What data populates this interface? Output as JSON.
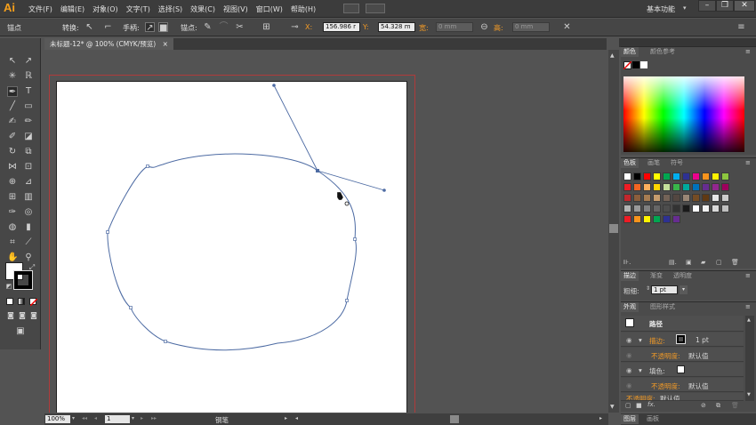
{
  "app": {
    "logo": "Ai",
    "menu": [
      "文件(F)",
      "编辑(E)",
      "对象(O)",
      "文字(T)",
      "选择(S)",
      "效果(C)",
      "视图(V)",
      "窗口(W)",
      "帮助(H)"
    ],
    "workspace": "基本功能"
  },
  "control_bar": {
    "object_label": "锚点",
    "convert_label": "转换:",
    "handles_label": "手柄:",
    "anchors_label": "锚点:",
    "x_label": "X:",
    "x_value": "156.986 r",
    "y_label": "Y:",
    "y_value": "54.328 m",
    "w_label": "宽:",
    "w_value": "0 mm",
    "h_label": "高:",
    "h_value": "0 mm"
  },
  "document": {
    "tab_title": "未标题-12* @ 100% (CMYK/预览)"
  },
  "status_bar": {
    "zoom": "100%",
    "page": "1",
    "tool": "钢笔"
  },
  "panels": {
    "color": {
      "tabs": [
        "颜色",
        "颜色参考"
      ]
    },
    "swatches": {
      "tabs": [
        "色板",
        "画笔",
        "符号"
      ],
      "colors": [
        "#ffffff",
        "#000000",
        "#ff0000",
        "#ffff00",
        "#00a650",
        "#00aeef",
        "#2e3192",
        "#ec008c",
        "#f7941d",
        "#fff200",
        "#8dc63f",
        "#ed1c24",
        "#f26522",
        "#fbaf5d",
        "#ffd600",
        "#c4df9b",
        "#39b54a",
        "#00a99d",
        "#0072bc",
        "#662d91",
        "#92278f",
        "#9e005d",
        "#c1272d",
        "#8b5e3c",
        "#a67c52",
        "#c69c6d",
        "#736357",
        "#534741",
        "#998675",
        "#754c24",
        "#603913",
        "#e6e6e6",
        "#cccccc",
        "#b3b3b3",
        "#999999",
        "#808080",
        "#666666",
        "#4d4d4d",
        "#333333",
        "#1a1a1a",
        "#ffffff",
        "#f2f2f2",
        "#d9d9d9",
        "#bfbfbf",
        "#ee1c25",
        "#f7941d",
        "#fff200",
        "#00a651",
        "#2e3192",
        "#662d91"
      ]
    },
    "stroke": {
      "tabs": [
        "描边",
        "渐变",
        "透明度"
      ],
      "weight_label": "粗细:",
      "weight_value": "1 pt"
    },
    "appearance": {
      "tabs": [
        "外观",
        "图形样式"
      ],
      "title": "路径",
      "stroke_label": "描边:",
      "stroke_value": "1 pt",
      "opacity_label": "不透明度:",
      "opacity_value": "默认值",
      "fill_label": "填色:",
      "opacity2_label": "不透明度:",
      "opacity2_value": "默认值",
      "opacity3_label": "不透明度:",
      "opacity3_value": "默认值"
    },
    "bottom_tabs": [
      "图层",
      "画板"
    ]
  }
}
